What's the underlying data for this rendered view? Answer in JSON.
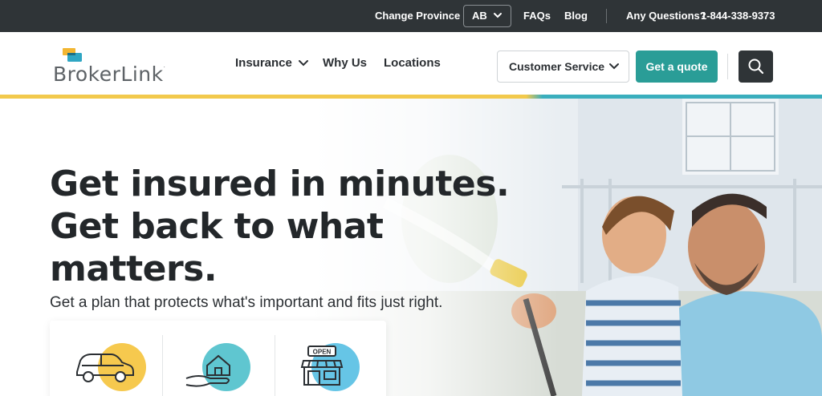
{
  "topbar": {
    "change_province": "Change Province",
    "province": "AB",
    "faqs": "FAQs",
    "blog": "Blog",
    "questions_label": "Any Questions?",
    "phone": "1-844-338-9373"
  },
  "header": {
    "logo_text": "BrokerLink",
    "nav": {
      "insurance": "Insurance",
      "why_us": "Why Us",
      "locations": "Locations"
    },
    "customer_service": "Customer Service",
    "get_quote": "Get a quote"
  },
  "hero": {
    "title_lines": [
      "Get insured in minutes.",
      "Get back to what",
      "matters."
    ],
    "subtitle": "Get a plan that protects what's important and fits just right.",
    "cards": [
      {
        "icon": "car-insurance-icon",
        "accent": "#f6c94e"
      },
      {
        "icon": "home-insurance-icon",
        "accent": "#5fc6d0"
      },
      {
        "icon": "business-insurance-icon",
        "accent": "#66c5e6"
      }
    ],
    "open_sign": "OPEN"
  },
  "colors": {
    "topbar_bg": "#2f3437",
    "accent_yellow": "#f2c94c",
    "accent_teal": "#2a9d97",
    "question_color": "#f6c342"
  }
}
